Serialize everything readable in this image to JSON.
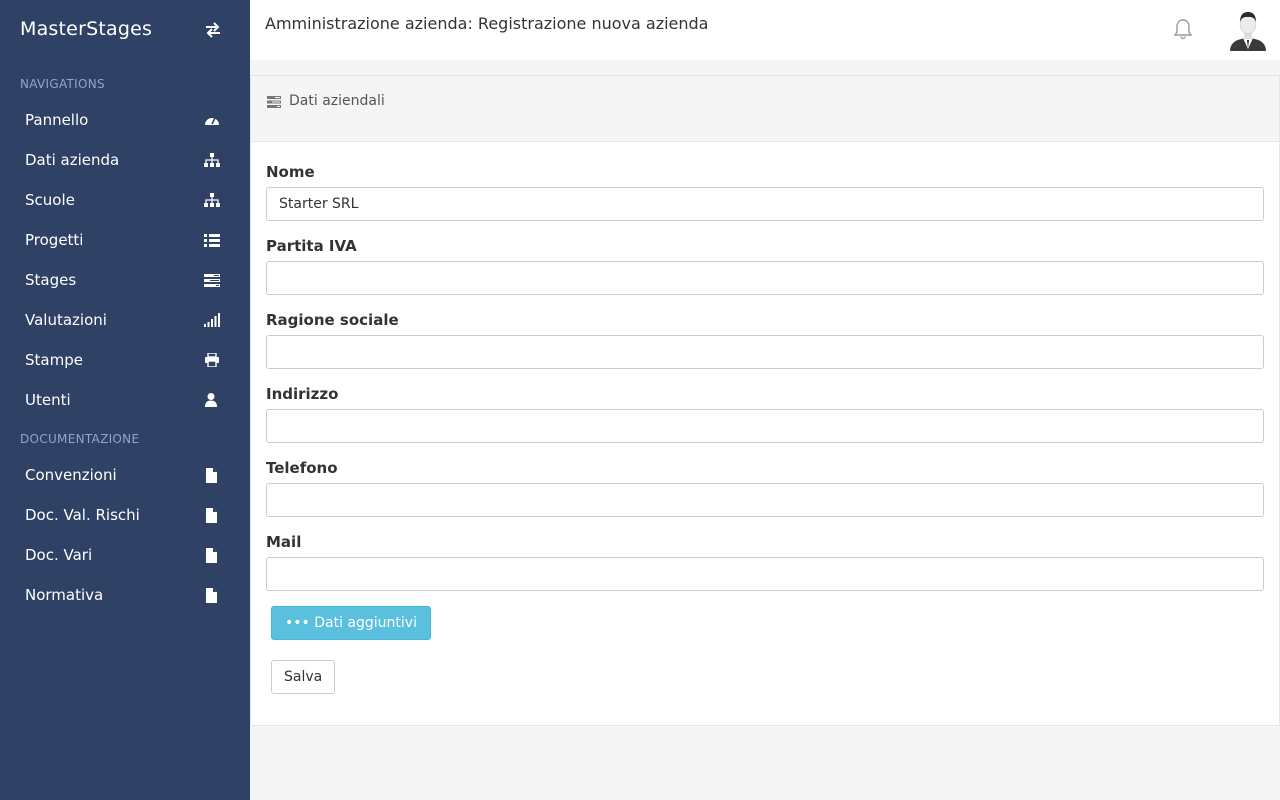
{
  "sidebar": {
    "brand": "MasterStages",
    "sections": [
      {
        "title": "NAVIGATIONS"
      },
      {
        "title": "DOCUMENTAZIONE"
      }
    ],
    "nav": [
      {
        "label": "Pannello",
        "icon": "dashboard-icon"
      },
      {
        "label": "Dati azienda",
        "icon": "sitemap-icon"
      },
      {
        "label": "Scuole",
        "icon": "sitemap-icon"
      },
      {
        "label": "Progetti",
        "icon": "list-icon"
      },
      {
        "label": "Stages",
        "icon": "tasks-icon"
      },
      {
        "label": "Valutazioni",
        "icon": "signal-icon"
      },
      {
        "label": "Stampe",
        "icon": "print-icon"
      },
      {
        "label": "Utenti",
        "icon": "user-icon"
      }
    ],
    "docs": [
      {
        "label": "Convenzioni",
        "icon": "file-icon"
      },
      {
        "label": "Doc. Val. Rischi",
        "icon": "file-icon"
      },
      {
        "label": "Doc. Vari",
        "icon": "file-icon"
      },
      {
        "label": "Normativa",
        "icon": "file-icon"
      }
    ]
  },
  "header": {
    "title": "Amministrazione azienda: Registrazione nuova azienda"
  },
  "panel": {
    "heading": "Dati aziendali",
    "fields": [
      {
        "label": "Nome",
        "value": "Starter SRL"
      },
      {
        "label": "Partita IVA",
        "value": ""
      },
      {
        "label": "Ragione sociale",
        "value": ""
      },
      {
        "label": "Indirizzo",
        "value": ""
      },
      {
        "label": "Telefono",
        "value": ""
      },
      {
        "label": "Mail",
        "value": ""
      }
    ],
    "extra_button": "••• Dati aggiuntivi",
    "save_button": "Salva"
  },
  "colors": {
    "sidebar_bg": "#2f4164",
    "section_title": "#8fa5cf",
    "info_button": "#5bc0de"
  }
}
